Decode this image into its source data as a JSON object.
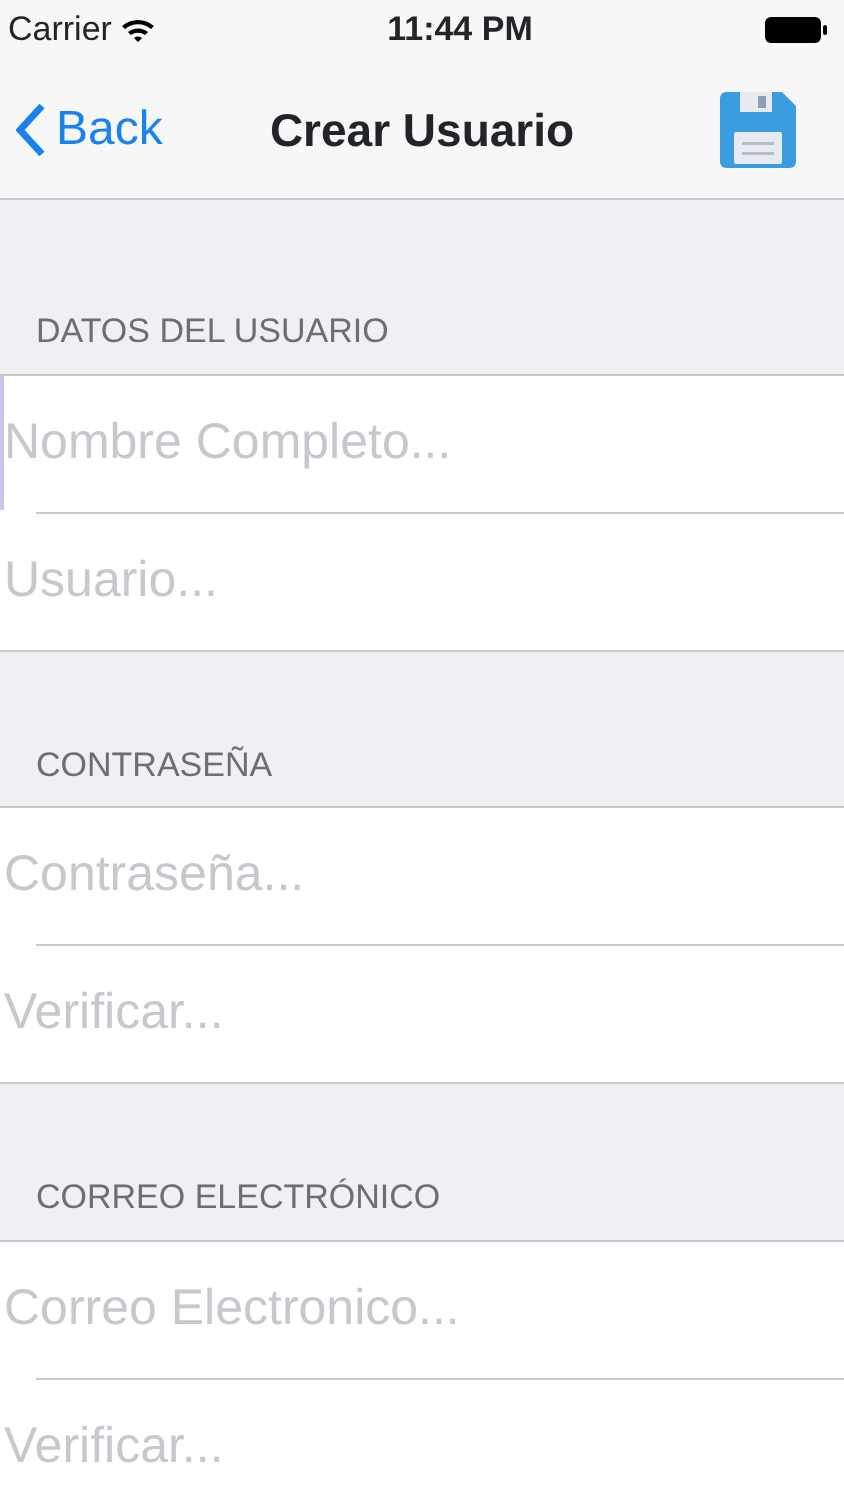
{
  "status_bar": {
    "carrier": "Carrier",
    "time": "11:44 PM"
  },
  "nav_bar": {
    "back": "Back",
    "title": "Crear Usuario"
  },
  "sections": [
    {
      "header": "DATOS DEL USUARIO",
      "fields": [
        {
          "placeholder": "Nombre Completo...",
          "focused": true
        },
        {
          "placeholder": "Usuario...",
          "focused": false
        }
      ]
    },
    {
      "header": "CONTRASEÑA",
      "fields": [
        {
          "placeholder": "Contraseña...",
          "focused": false
        },
        {
          "placeholder": "Verificar...",
          "focused": false
        }
      ]
    },
    {
      "header": "CORREO ELECTRÓNICO",
      "fields": [
        {
          "placeholder": "Correo Electronico...",
          "focused": false
        },
        {
          "placeholder": "Verificar...",
          "focused": false
        }
      ]
    }
  ]
}
